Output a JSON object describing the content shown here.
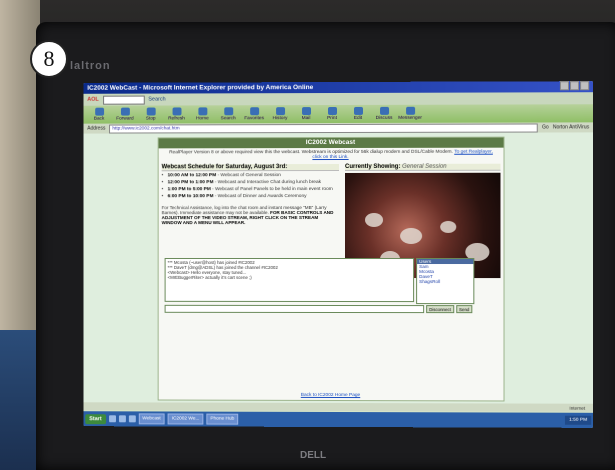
{
  "photo": {
    "badge_number": "8",
    "monitor_brand": "laltron",
    "monitor_bottom_brand": "DELL"
  },
  "window": {
    "title": "IC2002 WebCast - Microsoft Internet Explorer provided by America Online",
    "aol_search_label": "Search"
  },
  "toolbar": {
    "buttons": [
      "Back",
      "Forward",
      "Stop",
      "Refresh",
      "Home",
      "Search",
      "Favorites",
      "History",
      "Mail",
      "Print",
      "Edit",
      "Discuss",
      "Messenger"
    ]
  },
  "address": {
    "label": "Address",
    "url": "http://www.ic2002.com/chat.htm",
    "go_label": "Go",
    "links_label": "Norton AntiVirus"
  },
  "page": {
    "heading": "IC2002 Webcast",
    "notice_text": "RealPlayer Version 8 or above required view this the webcast. Webstream is optimized for 56k dialup modem and DSL/Cable Modem.",
    "notice_link": "To get Realplayer, click on this Link.",
    "schedule_title": "Webcast Schedule for Saturday, August 3rd:",
    "schedule": [
      {
        "time": "10:00 AM to 12:00 PM",
        "desc": "Webcast of General Session"
      },
      {
        "time": "12:00 PM to 1:00 PM",
        "desc": "Webcast and Interactive Chat during lunch break"
      },
      {
        "time": "1:00 PM to 5:00 PM",
        "desc": "Webcast of Panel Panels to be held in main event room"
      },
      {
        "time": "6:00 PM to 10:00 PM",
        "desc": "Webcast of Dinner and Awards Ceremony"
      }
    ],
    "assist_text": "For Technical Assistance, log into the chat room and instant message \"MB\" (Larry Barnes). Immediate assistance may not be available.",
    "assist_bold": "FOR BASIC CONTROLS AND ADJUSTMENT OF THE VIDEO STREAM, RIGHT CLICK ON THE STREAM WINDOW AND A MENU WILL APPEAR.",
    "showing_label": "Currently Showing:",
    "showing_value": "General Session",
    "chat_lines": [
      "*** Mcosta (~user@host) has joined #IC2002",
      "*** DaveT (dmg@ADSL) has joined the channel #IC2002",
      "<Webcast> Hello everyone, stay tuned...",
      "<MrEBuggerRiter> actually it's cart scene ;)"
    ],
    "users_header": "Users",
    "users": [
      "Sam",
      "Mcosta",
      "DaveT",
      "ShagsRoll"
    ],
    "disconnect_label": "Disconnect",
    "send_label": "Send",
    "back_link": "Back to IC2002 Home Page"
  },
  "status": {
    "zone": "Internet"
  },
  "taskbar": {
    "start_label": "Start",
    "tasks": [
      "Webcast",
      "IC2002 We...",
      "Phone Hub"
    ],
    "clock": "1:50 PM"
  }
}
